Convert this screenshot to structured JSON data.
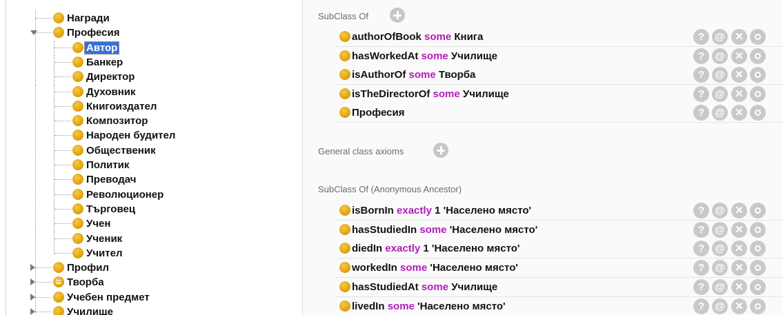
{
  "tree": {
    "partial_top_label": "Награди",
    "items": [
      {
        "label": "Награди",
        "expander": "none",
        "selected": false,
        "icon": "class-icon"
      },
      {
        "label": "Професия",
        "expander": "expanded",
        "selected": false,
        "icon": "class-icon"
      },
      {
        "label": "Автор",
        "expander": "none",
        "selected": true,
        "icon": "class-icon"
      },
      {
        "label": "Банкер",
        "expander": "none",
        "selected": false,
        "icon": "class-icon"
      },
      {
        "label": "Директор",
        "expander": "none",
        "selected": false,
        "icon": "class-icon"
      },
      {
        "label": "Духовник",
        "expander": "none",
        "selected": false,
        "icon": "class-icon"
      },
      {
        "label": "Книгоиздател",
        "expander": "none",
        "selected": false,
        "icon": "class-icon"
      },
      {
        "label": "Композитор",
        "expander": "none",
        "selected": false,
        "icon": "class-icon"
      },
      {
        "label": "Народен будител",
        "expander": "none",
        "selected": false,
        "icon": "class-icon"
      },
      {
        "label": "Общественик",
        "expander": "none",
        "selected": false,
        "icon": "class-icon"
      },
      {
        "label": "Политик",
        "expander": "none",
        "selected": false,
        "icon": "class-icon"
      },
      {
        "label": "Преводач",
        "expander": "none",
        "selected": false,
        "icon": "class-icon"
      },
      {
        "label": "Революционер",
        "expander": "none",
        "selected": false,
        "icon": "class-icon"
      },
      {
        "label": "Търговец",
        "expander": "none",
        "selected": false,
        "icon": "class-icon"
      },
      {
        "label": "Учен",
        "expander": "none",
        "selected": false,
        "icon": "class-icon"
      },
      {
        "label": "Ученик",
        "expander": "none",
        "selected": false,
        "icon": "class-icon"
      },
      {
        "label": "Учител",
        "expander": "none",
        "selected": false,
        "icon": "class-icon"
      },
      {
        "label": "Профил",
        "expander": "collapsed",
        "selected": false,
        "icon": "class-icon"
      },
      {
        "label": "Творба",
        "expander": "collapsed",
        "selected": false,
        "icon": "equivalent-class-icon"
      },
      {
        "label": "Учебен предмет",
        "expander": "collapsed",
        "selected": false,
        "icon": "class-icon"
      },
      {
        "label": "Училище",
        "expander": "collapsed",
        "selected": false,
        "icon": "class-icon"
      }
    ]
  },
  "detail": {
    "subclass_of": {
      "header": "SubClass Of",
      "axioms": [
        [
          {
            "t": "authorOfBook "
          },
          {
            "t": "some",
            "kw": true
          },
          {
            "t": " Книга"
          }
        ],
        [
          {
            "t": "hasWorkedAt "
          },
          {
            "t": "some",
            "kw": true
          },
          {
            "t": " Училище"
          }
        ],
        [
          {
            "t": "isAuthorOf "
          },
          {
            "t": "some",
            "kw": true
          },
          {
            "t": " Творба"
          }
        ],
        [
          {
            "t": "isTheDirectorOf "
          },
          {
            "t": "some",
            "kw": true
          },
          {
            "t": " Училище"
          }
        ],
        [
          {
            "t": "Професия"
          }
        ]
      ]
    },
    "general_class_axioms": {
      "header": "General class axioms"
    },
    "anonymous_ancestor": {
      "header": "SubClass Of (Anonymous Ancestor)",
      "axioms": [
        [
          {
            "t": "isBornIn "
          },
          {
            "t": "exactly",
            "kw": true
          },
          {
            "t": " 1 'Населено място'"
          }
        ],
        [
          {
            "t": "hasStudiedIn "
          },
          {
            "t": "some",
            "kw": true
          },
          {
            "t": " 'Населено място'"
          }
        ],
        [
          {
            "t": "diedIn "
          },
          {
            "t": "exactly",
            "kw": true
          },
          {
            "t": " 1 'Населено място'"
          }
        ],
        [
          {
            "t": "workedIn "
          },
          {
            "t": "some",
            "kw": true
          },
          {
            "t": " 'Населено място'"
          }
        ],
        [
          {
            "t": "hasStudiedAt "
          },
          {
            "t": "some",
            "kw": true
          },
          {
            "t": " Училище"
          }
        ],
        [
          {
            "t": "livedIn "
          },
          {
            "t": "some",
            "kw": true
          },
          {
            "t": " 'Населено място'"
          }
        ]
      ]
    },
    "row_buttons": [
      {
        "name": "explain-button",
        "glyph": "?"
      },
      {
        "name": "annotate-button",
        "glyph": "@"
      },
      {
        "name": "delete-button",
        "glyph": "✕"
      },
      {
        "name": "edit-button",
        "glyph": ""
      }
    ]
  },
  "colors": {
    "keyword": "#b21cbb",
    "class_icon": "#e3a713",
    "selection": "#3a6fd8",
    "button_gray": "#c9c9c9"
  }
}
